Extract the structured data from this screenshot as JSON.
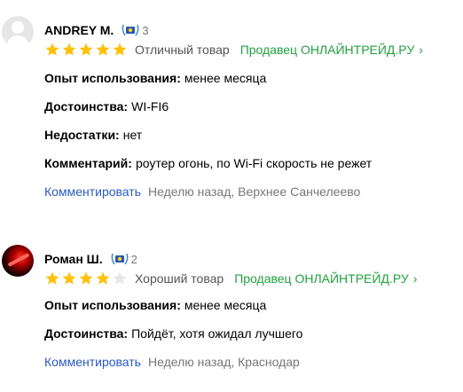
{
  "reviews": [
    {
      "author": "ANDREY M.",
      "badge_count": "3",
      "rating": 5,
      "verdict": "Отличный товар",
      "seller_link": "Продавец ОНЛАЙНТРЕЙД.РУ",
      "fields": [
        {
          "label": "Опыт использования:",
          "value": "менее месяца"
        },
        {
          "label": "Достоинства:",
          "value": "WI-FI6"
        },
        {
          "label": "Недостатки:",
          "value": "нет"
        },
        {
          "label": "Комментарий:",
          "value": "роутер огонь, по Wi-Fi скорость не режет"
        }
      ],
      "comment_action": "Комментировать",
      "meta": "Неделю назад, Верхнее Санчелеево"
    },
    {
      "author": "Роман Ш.",
      "badge_count": "2",
      "rating": 4,
      "verdict": "Хороший товар",
      "seller_link": "Продавец ОНЛАЙНТРЕЙД.РУ",
      "fields": [
        {
          "label": "Опыт использования:",
          "value": "менее месяца"
        },
        {
          "label": "Достоинства:",
          "value": "Пойдёт, хотя ожидал лучшего"
        }
      ],
      "comment_action": "Комментировать",
      "meta": "Неделю назад, Краснодар"
    }
  ],
  "icons": {
    "star": "star-icon",
    "badge": "laurel-badge-icon",
    "chevron": "›",
    "avatar_default": "user-silhouette-icon"
  },
  "colors": {
    "star_filled": "#ffc107",
    "star_empty": "#e6e6e6",
    "seller_green": "#22a040",
    "link_blue": "#2a5ac0",
    "muted_gray": "#777777"
  }
}
